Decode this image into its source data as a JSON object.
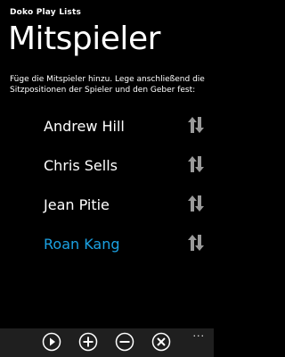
{
  "app": {
    "title": "Doko Play Lists"
  },
  "page": {
    "title": "Mitspieler",
    "description": "Füge die Mitspieler hinzu. Lege anschließend die Sitzpositionen der Spieler und den Geber fest:"
  },
  "players": [
    {
      "name": "Andrew Hill"
    },
    {
      "name": "Chris Sells"
    },
    {
      "name": "Jean Pitie"
    },
    {
      "name": "Roan Kang"
    }
  ],
  "colors": {
    "accent": "#1ba1e2",
    "background": "#000000",
    "appbar": "#1f1f1f"
  },
  "appbar": {
    "buttons": [
      "play-icon",
      "add-icon",
      "remove-icon",
      "close-icon"
    ],
    "more": "..."
  }
}
